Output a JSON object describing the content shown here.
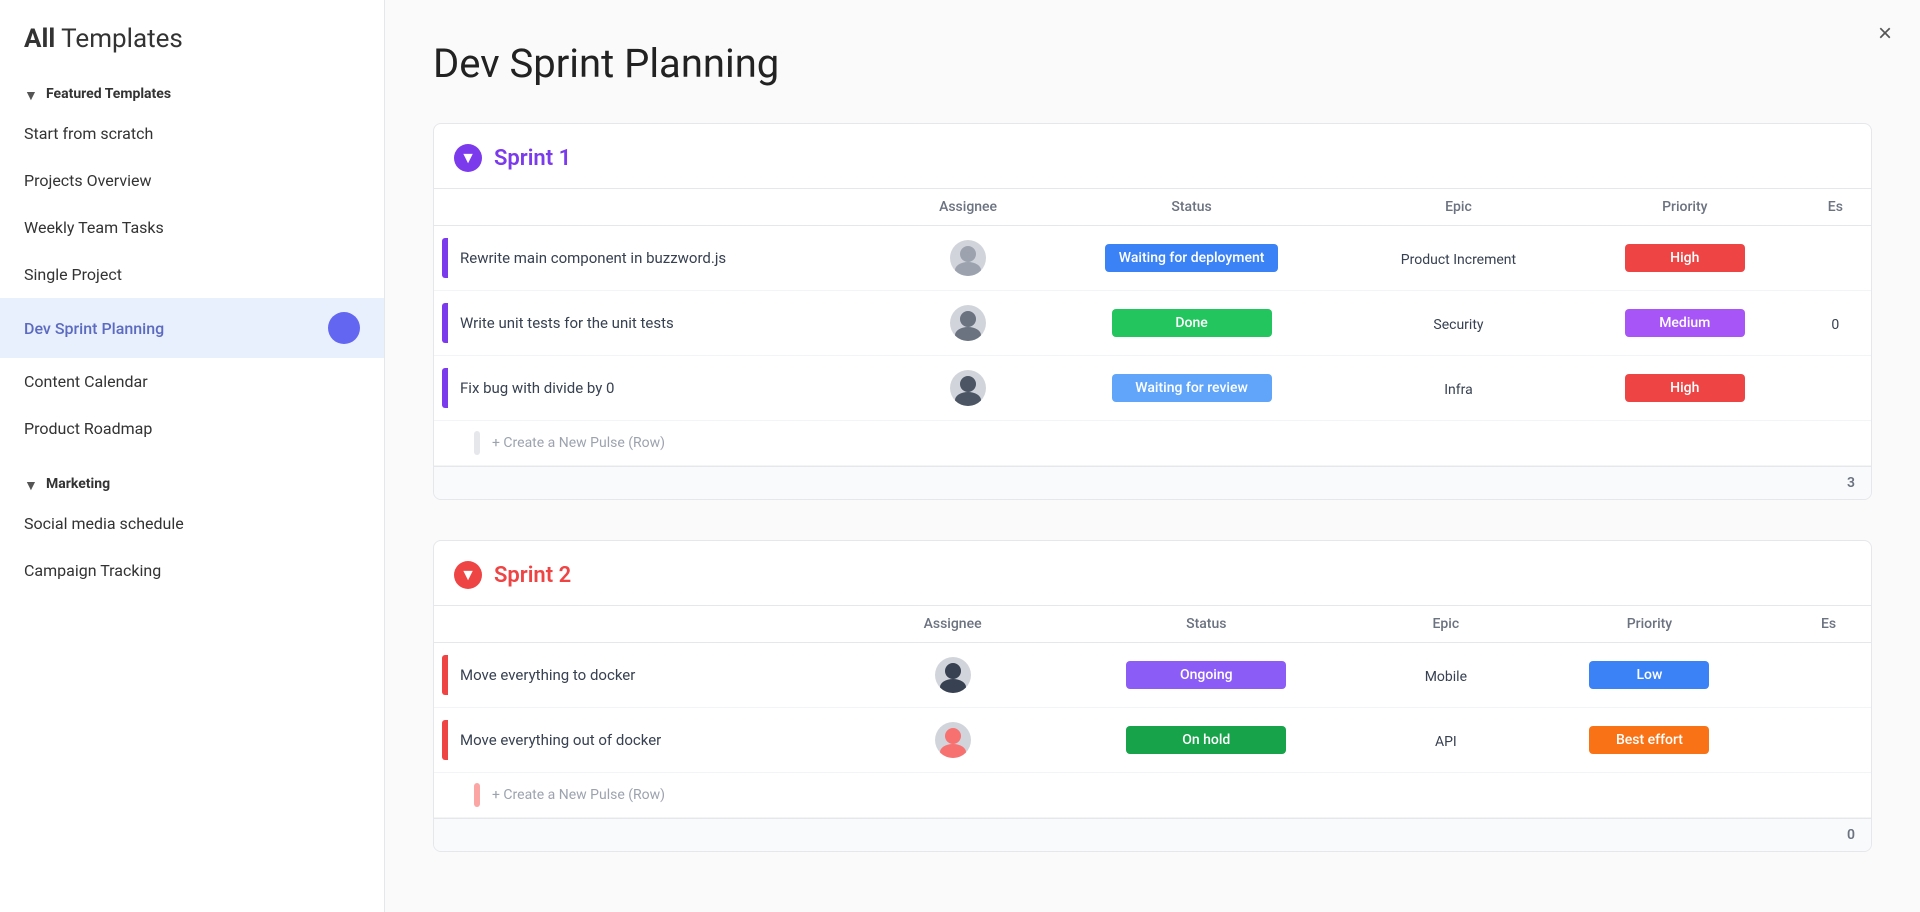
{
  "sidebar": {
    "title_bold": "All",
    "title_rest": " Templates",
    "sections": [
      {
        "name": "Featured Templates",
        "collapsed": false,
        "items": [
          {
            "id": "start-scratch",
            "label": "Start from scratch",
            "active": false
          },
          {
            "id": "projects-overview",
            "label": "Projects Overview",
            "active": false
          },
          {
            "id": "weekly-team-tasks",
            "label": "Weekly Team Tasks",
            "active": false
          },
          {
            "id": "single-project",
            "label": "Single Project",
            "active": false
          },
          {
            "id": "dev-sprint-planning",
            "label": "Dev Sprint Planning",
            "active": true
          },
          {
            "id": "content-calendar",
            "label": "Content Calendar",
            "active": false
          },
          {
            "id": "product-roadmap",
            "label": "Product Roadmap",
            "active": false
          }
        ]
      },
      {
        "name": "Marketing",
        "collapsed": false,
        "items": [
          {
            "id": "social-media-schedule",
            "label": "Social media schedule",
            "active": false
          },
          {
            "id": "campaign-tracking",
            "label": "Campaign Tracking",
            "active": false
          }
        ]
      }
    ]
  },
  "main": {
    "title": "Dev Sprint Planning",
    "close_label": "×",
    "sprints": [
      {
        "id": "sprint1",
        "name": "Sprint 1",
        "icon_type": "purple",
        "icon_char": "▼",
        "columns": [
          "Assignee",
          "Status",
          "Epic",
          "Priority",
          "Es"
        ],
        "rows": [
          {
            "task": "Rewrite main component in buzzword.js",
            "bar_color": "purple",
            "assignee_color": "#6b7280",
            "status": "Waiting for deployment",
            "status_class": "status-waiting-deploy",
            "epic": "Product Increment",
            "priority": "High",
            "priority_class": "priority-high",
            "es": ""
          },
          {
            "task": "Write unit tests for the unit tests",
            "bar_color": "purple",
            "assignee_color": "#374151",
            "status": "Done",
            "status_class": "status-done",
            "epic": "Security",
            "priority": "Medium",
            "priority_class": "priority-medium",
            "es": "0"
          },
          {
            "task": "Fix bug with divide by 0",
            "bar_color": "purple",
            "assignee_color": "#9ca3af",
            "status": "Waiting for review",
            "status_class": "status-waiting-review",
            "epic": "Infra",
            "priority": "High",
            "priority_class": "priority-high",
            "es": ""
          }
        ],
        "create_label": "+ Create a New Pulse (Row)",
        "number_badge": "3"
      },
      {
        "id": "sprint2",
        "name": "Sprint 2",
        "icon_type": "red",
        "icon_char": "▼",
        "columns": [
          "Assignee",
          "Status",
          "Epic",
          "Priority",
          "Es"
        ],
        "rows": [
          {
            "task": "Move everything to docker",
            "bar_color": "red",
            "assignee_color": "#4b5563",
            "status": "Ongoing",
            "status_class": "status-ongoing",
            "epic": "Mobile",
            "priority": "Low",
            "priority_class": "priority-low",
            "es": ""
          },
          {
            "task": "Move everything out of docker",
            "bar_color": "red",
            "assignee_color": "#f87171",
            "status": "On hold",
            "status_class": "status-on-hold",
            "epic": "API",
            "priority": "Best effort",
            "priority_class": "priority-best-effort",
            "es": ""
          }
        ],
        "create_label": "+ Create a New Pulse (Row)",
        "number_badge": "0"
      }
    ]
  }
}
